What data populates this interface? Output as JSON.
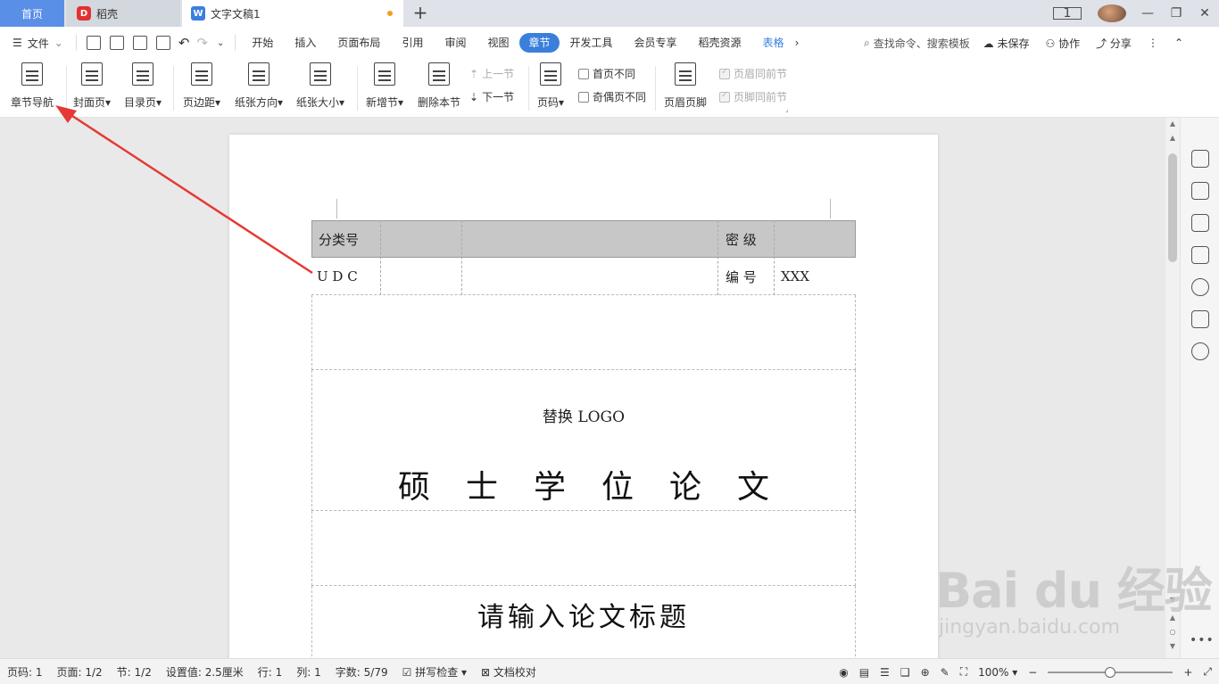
{
  "tabs": {
    "home": "首页",
    "daoke": "稻壳",
    "doc": "文字文稿1"
  },
  "menu": {
    "file": "文件",
    "items": [
      "开始",
      "插入",
      "页面布局",
      "引用",
      "审阅",
      "视图",
      "章节",
      "开发工具",
      "会员专享",
      "稻壳资源",
      "表格"
    ],
    "active": "章节",
    "search": "查找命令、搜索模板",
    "unsaved": "未保存",
    "collab": "协作",
    "share": "分享"
  },
  "ribbon": {
    "chapter_nav": "章节导航",
    "cover": "封面页",
    "toc": "目录页",
    "margin": "页边距",
    "orientation": "纸张方向",
    "size": "纸张大小",
    "new_section": "新增节",
    "delete_section": "删除本节",
    "prev_section": "上一节",
    "next_section": "下一节",
    "page_number": "页码",
    "first_page_diff": "首页不同",
    "odd_even_diff": "奇偶页不同",
    "header_footer": "页眉页脚",
    "same_header": "页眉同前节",
    "same_footer": "页脚同前节"
  },
  "document": {
    "cls_no": "分类号",
    "secret": "密  级",
    "udc": "U D C",
    "number": "编  号",
    "number_value": "XXX",
    "logo": "替换 LOGO",
    "thesis_type": "硕士学位论文",
    "title_placeholder": "请输入论文标题"
  },
  "status": {
    "page": "页码: 1",
    "pages": "页面: 1/2",
    "section": "节: 1/2",
    "setting": "设置值: 2.5厘米",
    "row": "行: 1",
    "col": "列: 1",
    "words": "字数: 5/79",
    "spell": "拼写检查",
    "proof": "文档校对",
    "zoom": "100%"
  },
  "watermark": {
    "main": "Bai du 经验",
    "sub": "jingyan.baidu.com"
  },
  "colors": {
    "accent": "#3a7fdc",
    "home_tab": "#5a8fe8",
    "arrow": "#e53935",
    "table_header": "#c7c7c7"
  }
}
